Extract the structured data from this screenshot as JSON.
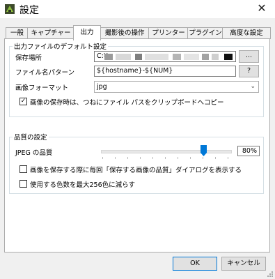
{
  "window": {
    "title": "設定",
    "close_icon": "close-icon"
  },
  "tabs": [
    {
      "label": "一般"
    },
    {
      "label": "キャプチャー"
    },
    {
      "label": "出力",
      "active": true
    },
    {
      "label": "撮影後の操作"
    },
    {
      "label": "プリンター"
    },
    {
      "label": "プラグイン"
    },
    {
      "label": "高度な設定"
    }
  ],
  "output": {
    "group_label": "出力ファイルのデフォルト設定",
    "save_location_label": "保存場所",
    "save_location_value": "C:¥",
    "browse_label": "...",
    "filename_pattern_label": "ファイル名パターン",
    "filename_pattern_value": "${hostname}-${NUM}",
    "help_label": "?",
    "image_format_label": "画像フォーマット",
    "image_format_value": "jpg",
    "copy_path_checked": true,
    "copy_path_label": "画像の保存時は、つねにファイル パスをクリップボードへコピー"
  },
  "quality": {
    "group_label": "品質の設定",
    "jpeg_label": "JPEG の品質",
    "jpeg_value_percent": 80,
    "jpeg_value_text": "80%",
    "ask_quality_checked": false,
    "ask_quality_label": "画像を保存する際に毎回「保存する画像の品質」ダイアログを表示する",
    "reduce_colors_checked": false,
    "reduce_colors_label": "使用する色数を最大256色に減らす"
  },
  "buttons": {
    "ok": "OK",
    "cancel": "キャンセル"
  },
  "colors": {
    "accent": "#0078d7",
    "redaction": "#c8c8c8"
  }
}
